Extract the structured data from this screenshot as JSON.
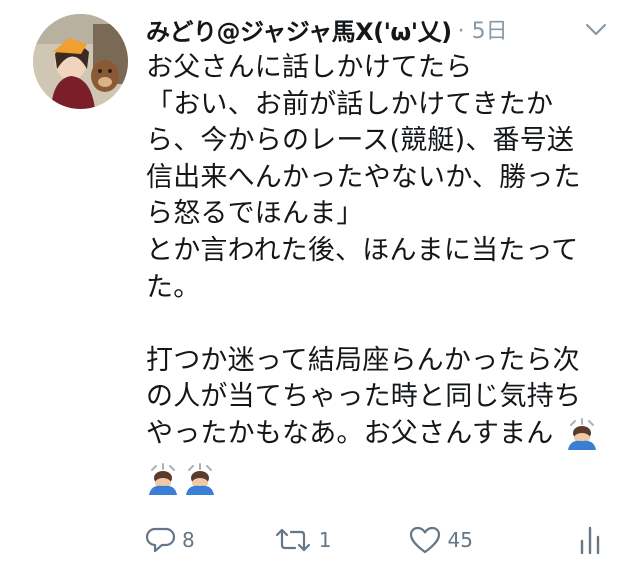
{
  "tweet": {
    "author_name": "みどり@ジャジャ馬X('ω'乂)",
    "time": "· 5日",
    "lines": [
      "お父さんに話しかけてたら",
      "「おい、お前が話しかけてきたか",
      "ら、今からのレース(競艇)、番号送",
      "信出来へんかったやないか、勝った",
      "ら怒るでほんま」",
      "とか言われた後、ほんまに当たって",
      "た。",
      "",
      "打つか迷って結局座らんかったら次",
      "の人が当てちゃった時と同じ気持ち",
      "やったかもなあ。お父さんすまん"
    ]
  },
  "actions": {
    "reply_count": "8",
    "retweet_count": "1",
    "like_count": "45"
  },
  "icons": {
    "reply": "reply-icon",
    "retweet": "retweet-icon",
    "like": "heart-icon",
    "stats": "analytics-icon",
    "chevron": "chevron-down-icon",
    "emoji": "bowing-person-emoji"
  },
  "colors": {
    "text": "#14171a",
    "muted": "#8899a6",
    "action": "#657786"
  }
}
